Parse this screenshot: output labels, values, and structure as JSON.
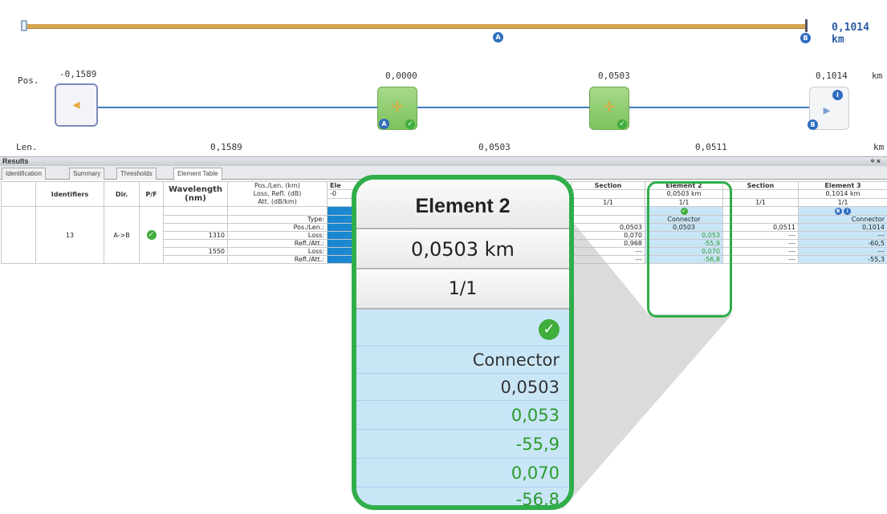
{
  "overview": {
    "total_length": "0,1014 km",
    "badge_a": "A",
    "badge_b": "B",
    "pos_label": "Pos.",
    "len_label": "Len.",
    "km_unit": "km",
    "positions": [
      "-0,1589",
      "0,0000",
      "0,0503",
      "0,1014"
    ],
    "lengths": [
      "0,1589",
      "0,0503",
      "0,0511"
    ]
  },
  "results": {
    "title": "Results",
    "pin": "ᵠ ×",
    "tabs": [
      "Identification",
      "Summary",
      "Thresholds",
      "Element Table"
    ],
    "active_tab": "Element Table",
    "headers": {
      "identifiers": "Identifiers",
      "dir": "Dir.",
      "pf": "P/F",
      "wavelength": "Wavelength (nm)",
      "poslen": [
        "Pos./Len. (km)",
        "Loss, Refl. (dB)",
        "Att. (dB/km)"
      ],
      "element1": "Ele",
      "element1_pos": "-0",
      "section": "Section",
      "element2": "Element 2",
      "element2_pos": "0,0503 km",
      "element3": "Element 3",
      "element3_pos": "0,1014 km",
      "ratio": "1/1"
    },
    "row": {
      "identifier": "13",
      "dir": "A->B",
      "wavelengths": [
        "1310",
        "1550"
      ],
      "types": [
        "Type:",
        "Pos./Len.:",
        "Loss:",
        "Refl./Att.:",
        "Loss:",
        "Refl./Att.:"
      ],
      "section_a": [
        "",
        "0,0503",
        "0,070",
        "0,968",
        "---",
        "---"
      ],
      "element2": [
        "Connector",
        "0,0503",
        "0,053",
        "-55,9",
        "0,070",
        "-56,8"
      ],
      "section_b": [
        "",
        "0,0511",
        "---",
        "---",
        "---",
        "---"
      ],
      "element3": [
        "Connector",
        "0,1014",
        "---",
        "-60,5",
        "---",
        "-55,3"
      ]
    }
  },
  "callout": {
    "title": "Element 2",
    "position": "0,0503 km",
    "ratio": "1/1",
    "type": "Connector",
    "pos": "0,0503",
    "loss_1310": "0,053",
    "refl_1310": "-55,9",
    "loss_1550": "0,070",
    "refl_1550": "-56,8"
  },
  "colors": {
    "highlight": "#2fae4a",
    "cell_blue": "#c9e6f7",
    "pass_green": "#2b9a2b"
  }
}
